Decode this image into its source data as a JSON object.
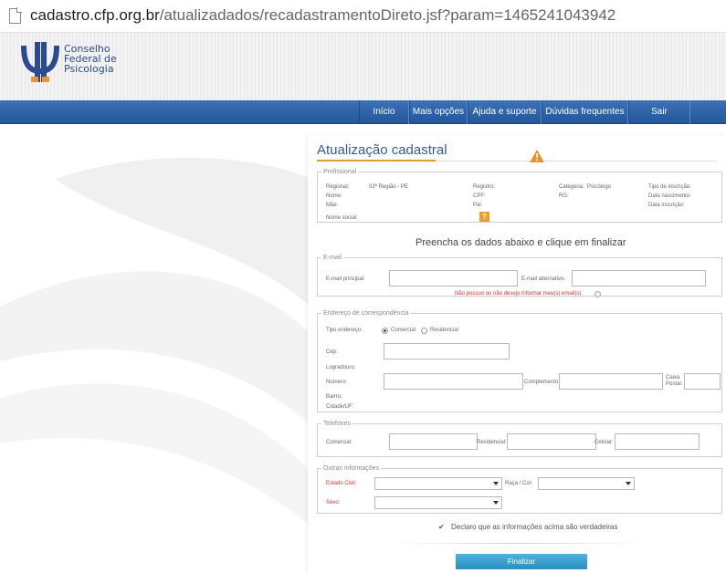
{
  "browser": {
    "url_domain": "cadastro.cfp.org.br",
    "url_path": "/atualizadados/recadastramentoDireto.jsf?param=1465241043942"
  },
  "logo": {
    "lines": [
      "Conselho",
      "Federal de",
      "Psicologia"
    ],
    "colors": {
      "text": "#2b4a8f",
      "mark": "#2b4a8f",
      "accent": "#e8982c"
    }
  },
  "nav": {
    "items": [
      "Início",
      "Mais opções",
      "Ajuda e suporte",
      "Dúvidas frequentes",
      "Sair"
    ],
    "colors": {
      "bg": "#2e62a8"
    }
  },
  "form": {
    "title": "Atualização cadastral",
    "professional": {
      "legend": "Profissional",
      "regional_label": "Regional:",
      "regional_value": "02ª Região - PE",
      "nome_label": "Nome:",
      "mae_label": "Mãe:",
      "nome_social_label": "Nome social:",
      "registro_label": "Registro:",
      "cpf_label": "CPF:",
      "pai_label": "Pai:",
      "categoria_label": "Categoria:",
      "categoria_value": "Psicólogo",
      "rg_label": "RG:",
      "tipo_inscricao_label": "Tipo de inscrição:",
      "data_nascimento_label": "Data nascimento:",
      "data_inscricao_label": "Data inscrição:",
      "help_glyph": "?"
    },
    "instruction": "Preencha os dados abaixo e clique em finalizar",
    "email": {
      "legend": "E-mail",
      "principal_label": "E-mail principal:",
      "alternativo_label": "E-mail alternativo:",
      "none_label": "Não possuo ou não desejo informar meu(s) email(s)",
      "principal_value": "",
      "alternativo_value": ""
    },
    "address": {
      "legend": "Endereço de correspondência",
      "tipo_label": "Tipo endereço:",
      "options": [
        "Comercial",
        "Residencial"
      ],
      "selected": "Comercial",
      "cep_label": "Cep:",
      "logradouro_label": "Logradouro:",
      "numero_label": "Número:",
      "complemento_label": "Complemento:",
      "caixa_postal_label_1": "Caixa",
      "caixa_postal_label_2": "Postal:",
      "bairro_label": "Bairro:",
      "cidade_label": "Cidade/UF:"
    },
    "phones": {
      "legend": "Telefones",
      "comercial_label": "Comercial:",
      "residencial_label": "Residencial:",
      "celular_label": "Celular:"
    },
    "other": {
      "legend": "Outras informações",
      "estado_civil_label": "Estado Civil:",
      "raca_label": "Raça / Cor:",
      "sexo_label": "Sexo:",
      "estado_civil_value": "",
      "raca_value": "",
      "sexo_value": ""
    },
    "declaration": "Declaro que as informações acima são verdadeiras",
    "submit_label": "Finalizar",
    "colors": {
      "title": "#2f5d97",
      "accent": "#e49d36",
      "required": "#d8312f",
      "button": "#3a9fd0"
    }
  }
}
